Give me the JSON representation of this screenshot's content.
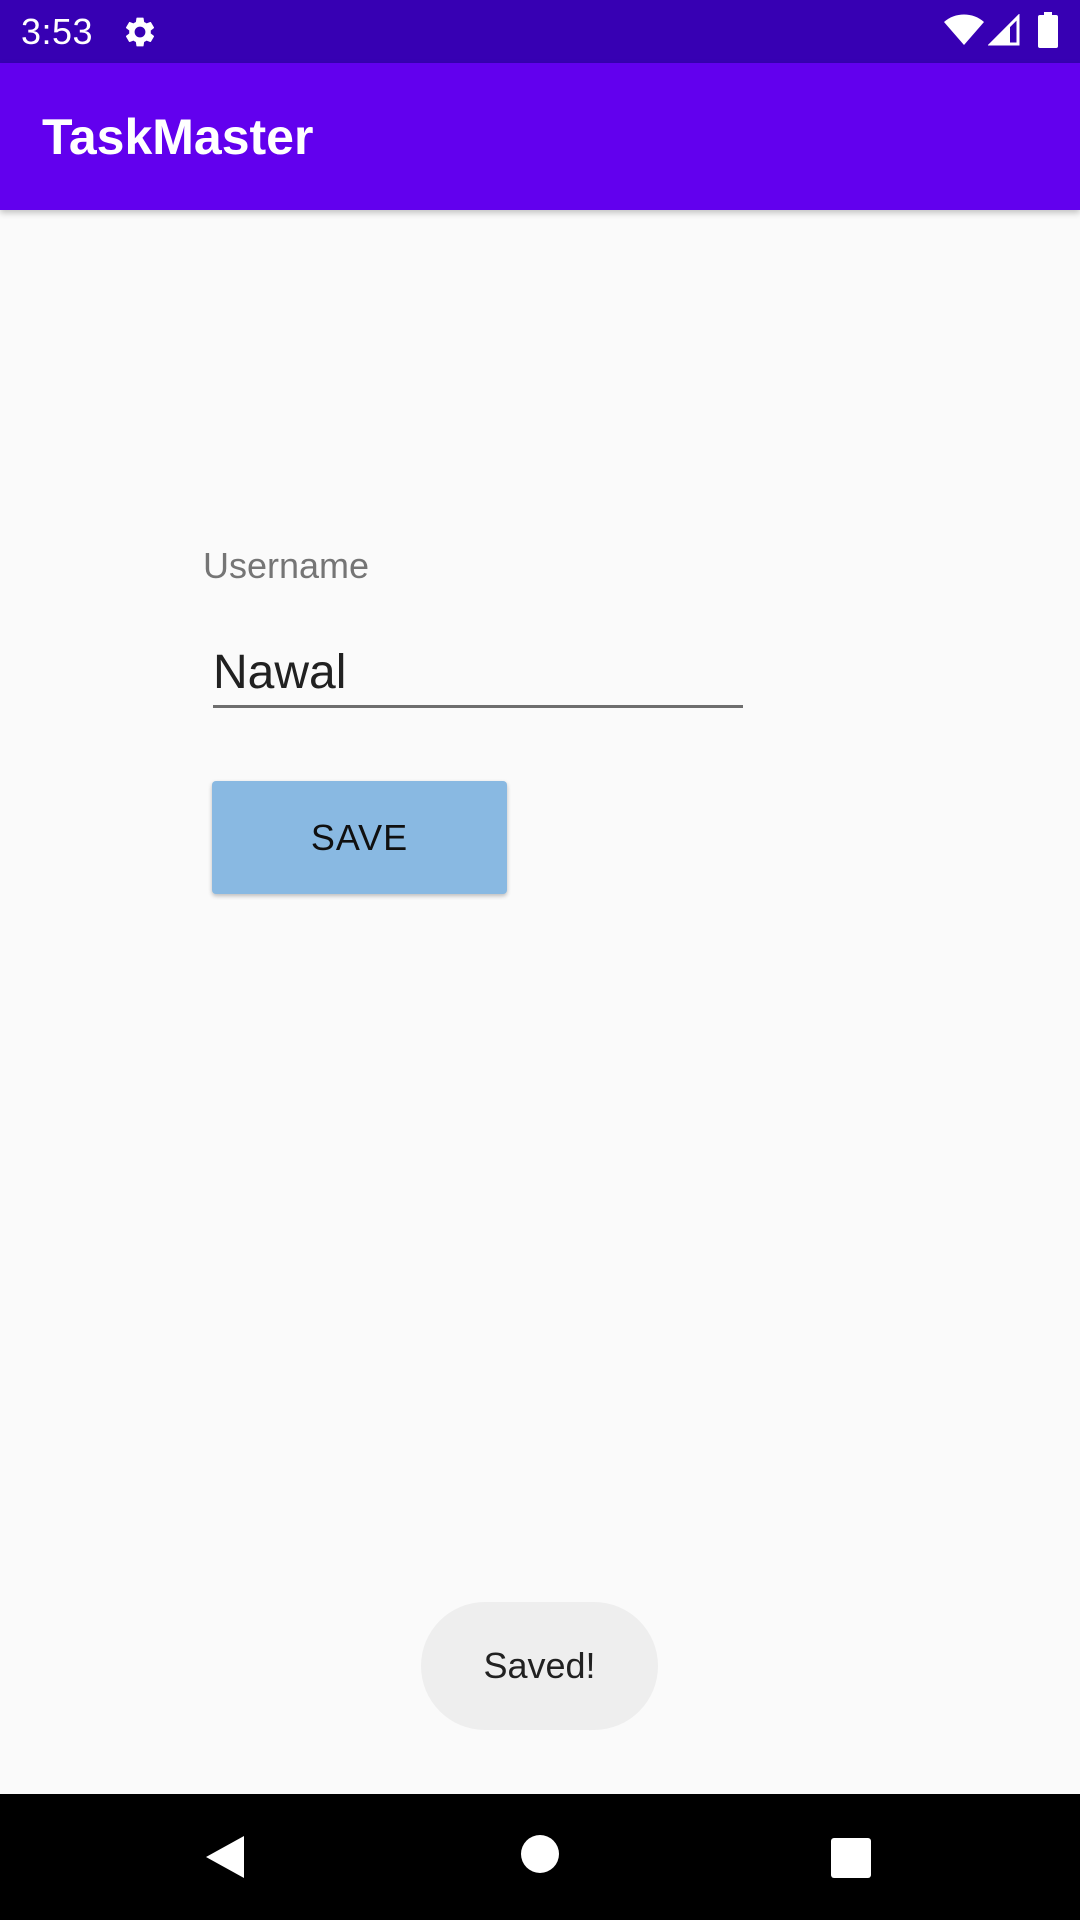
{
  "status_bar": {
    "time": "3:53",
    "icons": [
      "gear-icon",
      "wifi-icon",
      "cell-signal-icon",
      "battery-icon"
    ]
  },
  "app_bar": {
    "title": "TaskMaster",
    "color": "#6200ee",
    "status_color": "#3700b3"
  },
  "form": {
    "username_label": "Username",
    "username_value": "Nawal",
    "save_label": "SAVE",
    "save_button_color": "#89b9e2"
  },
  "toast": {
    "message": "Saved!"
  },
  "nav_bar": {
    "icons": [
      "back-icon",
      "home-icon",
      "recents-icon"
    ]
  }
}
